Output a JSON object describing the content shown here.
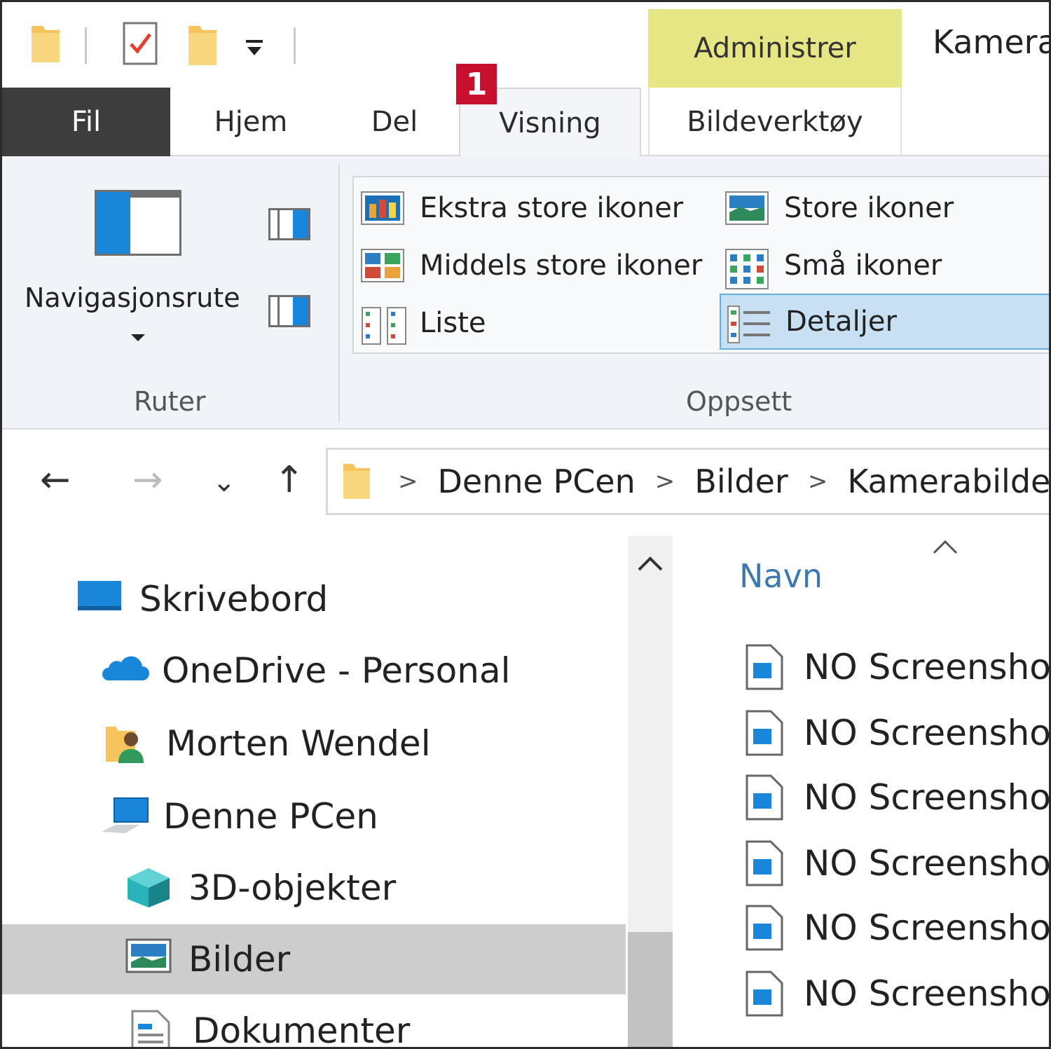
{
  "window": {
    "title": "Kamera"
  },
  "quick_access": {
    "icons": [
      "folder-icon",
      "properties-checkmark-icon",
      "new-folder-icon",
      "customize-dropdown-icon"
    ]
  },
  "badge": "1",
  "tabs": {
    "contextual_group": "Administrer",
    "items": [
      "Fil",
      "Hjem",
      "Del",
      "Visning",
      "Bildeverktøy"
    ],
    "active": "Visning"
  },
  "ribbon": {
    "panes_group": {
      "navigation_pane_label": "Navigasjonsrute",
      "group_label": "Ruter"
    },
    "layout_group": {
      "group_label": "Oppsett",
      "options": [
        "Ekstra store ikoner",
        "Store ikoner",
        "Middels store ikoner",
        "Små ikoner",
        "Liste",
        "Detaljer"
      ],
      "selected": "Detaljer"
    }
  },
  "address": {
    "breadcrumbs": [
      "Denne PCen",
      "Bilder",
      "Kamerabilde"
    ]
  },
  "nav_buttons": {
    "back": "←",
    "forward": "→",
    "recent": "⌄",
    "up": "↑"
  },
  "tree": {
    "items": [
      "Skrivebord",
      "OneDrive - Personal",
      "Morten Wendel",
      "Denne PCen",
      "3D-objekter",
      "Bilder",
      "Dokumenter"
    ],
    "selected": "Bilder"
  },
  "file_list": {
    "column_header": "Navn",
    "files": [
      "NO Screenshot_",
      "NO Screenshot_",
      "NO Screenshot_",
      "NO Screenshot_",
      "NO Screenshot_",
      "NO Screenshot_"
    ]
  },
  "colors": {
    "accent": "#1a86d9",
    "contextual_tab": "#e6e685",
    "selected_option": "#c7e1f3",
    "badge": "#c8102e"
  }
}
